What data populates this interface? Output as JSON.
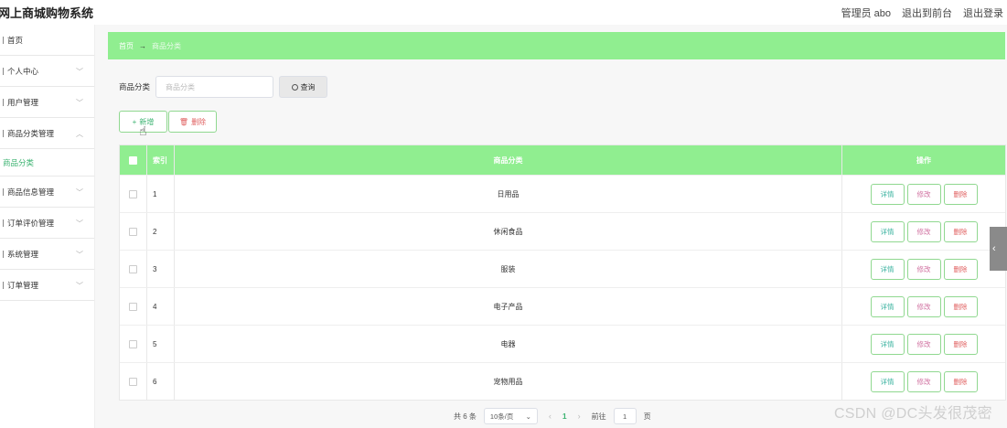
{
  "app": {
    "title": "网上商城购物系统"
  },
  "header": {
    "user": "管理员 abo",
    "to_front": "退出到前台",
    "logout": "退出登录"
  },
  "sidebar": {
    "items": [
      {
        "label": "首页",
        "expand": false
      },
      {
        "label": "个人中心",
        "expand": true
      },
      {
        "label": "用户管理",
        "expand": true
      },
      {
        "label": "商品分类管理",
        "expand": true,
        "open": true
      },
      {
        "label": "商品信息管理",
        "expand": true
      },
      {
        "label": "订单评价管理",
        "expand": true
      },
      {
        "label": "系统管理",
        "expand": true
      },
      {
        "label": "订单管理",
        "expand": true
      }
    ],
    "active_sub": "商品分类"
  },
  "breadcrumb": {
    "home": "首页",
    "arrow": "→",
    "current": "商品分类"
  },
  "search": {
    "label": "商品分类",
    "placeholder": "商品分类",
    "button": "查询"
  },
  "actions": {
    "add": "新增",
    "delete": "删除"
  },
  "table": {
    "headers": {
      "index": "索引",
      "category": "商品分类",
      "ops": "操作"
    },
    "rows": [
      {
        "index": "1",
        "category": "日用品"
      },
      {
        "index": "2",
        "category": "休闲食品"
      },
      {
        "index": "3",
        "category": "服装"
      },
      {
        "index": "4",
        "category": "电子产品"
      },
      {
        "index": "5",
        "category": "电器"
      },
      {
        "index": "6",
        "category": "宠物用品"
      }
    ],
    "ops": {
      "detail": "详情",
      "edit": "修改",
      "delete": "删除"
    }
  },
  "pagination": {
    "total": "共 6 条",
    "page_size": "10条/页",
    "prev": "‹",
    "current": "1",
    "next": "›",
    "goto_prefix": "前往",
    "goto_value": "1",
    "goto_suffix": "页"
  },
  "side_tab": "‹",
  "watermark": "CSDN @DC头发很茂密",
  "colors": {
    "accent": "#90ee90",
    "accent_text": "#3cb371",
    "danger": "#e06060"
  }
}
